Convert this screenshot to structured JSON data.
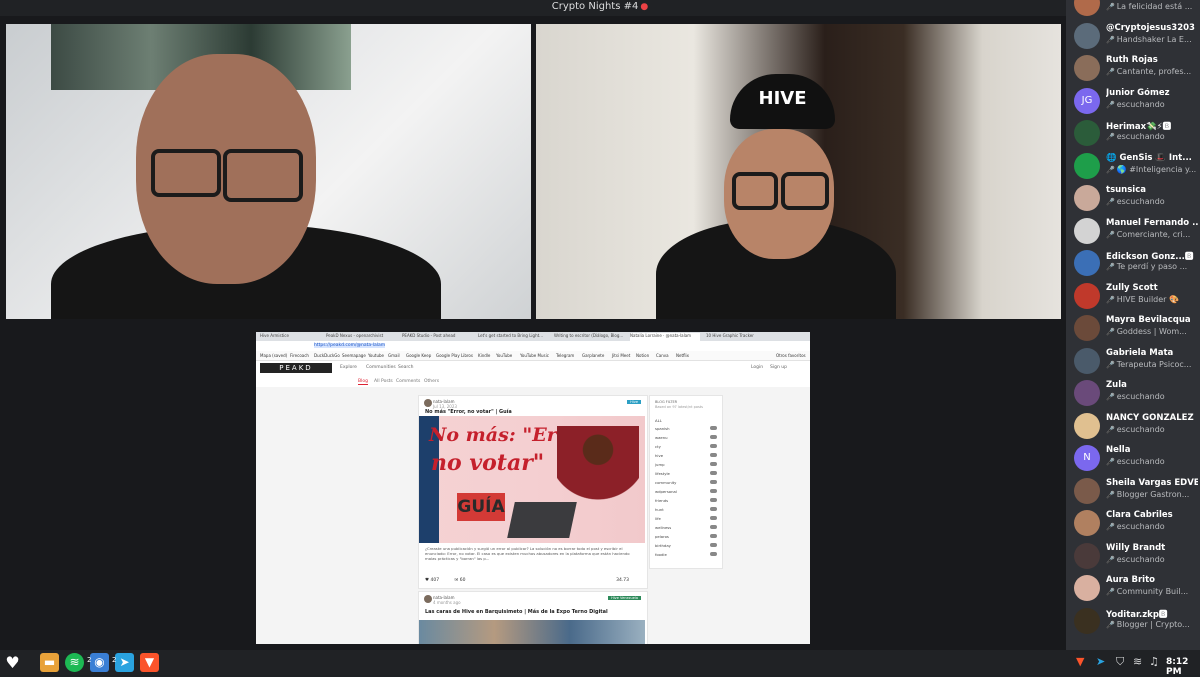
{
  "window": {
    "title": "Crypto Nights #4",
    "minimize": "─",
    "maximize": "❐",
    "close": "✕"
  },
  "video_right": {
    "cap_text": "HIVE"
  },
  "share": {
    "browser_tabs": [
      "Hive Armistice",
      "PeakD Nexus - openarchivist",
      "PEAKD Studio - Post ahead",
      "Let's get started to Bring Light...",
      "Writing to escritor (Diálogo, Blog...",
      "Natalia Lorraine · @nata-lalam",
      "10 Hive Graphic Tracker"
    ],
    "url": "https://peakd.com/@nata-lalam",
    "bookmarks": [
      "Mapa (saved)",
      "Firecoach",
      "DuckDuckGo",
      "Seemapage",
      "Youtube",
      "Gmail",
      "Google Keep",
      "Google Play Libros",
      "Kindle",
      "YouTube",
      "YouTube Music",
      "Telegram",
      "Garplanete",
      "Jitsi Meet",
      "Notion",
      "Canva",
      "Netflix",
      "Otros favoritos"
    ],
    "logo": "PEAKD",
    "nav": [
      "Explore",
      "Communities",
      "Search"
    ],
    "login": "Login",
    "signup": "Sign up",
    "subnav": [
      "Blog",
      "All Posts",
      "Comments",
      "Others"
    ],
    "post1": {
      "author": "nata-lalam",
      "age": "Jul 13, 2023",
      "badge": "Hive",
      "title": "No más \"Error, no votar\" | Guía",
      "image_line1": "No más: \"Error,",
      "image_line2": "no votar\"",
      "image_guia": "GUÍA",
      "excerpt": "¿Creaste una publicación y surgió un error al publicar? La solución no es borrar todo el post y escribir el enunciado: Error, no votar. El caso es que existen muchos abusadores en la plataforma que están haciendo malas prácticas y \"borran\" las p...",
      "votes": "407",
      "comments": "60",
      "payout": "34.73"
    },
    "post2": {
      "author": "nata-lalam",
      "age": "4 months ago",
      "badge": "Hive Venezuela",
      "title": "Las caras de Hive en Barquisimeto | Más de la Expo Terno Digital"
    },
    "filter": {
      "title": "BLOG FILTER",
      "subtitle": "Based on 97 latest/nt posts",
      "items": [
        "ALL",
        "spanish",
        "waenu",
        "cty",
        "hive",
        "jump",
        "lifestyle",
        "community",
        "wdpersonal",
        "friends",
        "hunt",
        "life",
        "wellness",
        "pelaros",
        "birthday",
        "foodie"
      ]
    }
  },
  "members": [
    {
      "name": "",
      "status": "La felicidad está ...",
      "color": "#b06a4a"
    },
    {
      "name": "@Cryptojesus3203",
      "status": "Handshaker La E...",
      "color": "#5b6b7a"
    },
    {
      "name": "Ruth Rojas",
      "status": "Cantante, profes...",
      "color": "#8a6d5a"
    },
    {
      "name": "Junior Gómez",
      "status": "escuchando",
      "color": "#7b68ee",
      "initials": "JG"
    },
    {
      "name": "Herimax💸⚡🅱",
      "status": "escuchando",
      "color": "#2b5c3a"
    },
    {
      "name": "🌐 GenSis 🎩 Int...",
      "status": "🌎 #Inteligencia y...",
      "color": "#1e9e4a"
    },
    {
      "name": "tsunsica",
      "status": "escuchando",
      "color": "#c9a99a"
    },
    {
      "name": "Manuel Fernando ...",
      "status": "Comerciante, cri...",
      "color": "#d3d3d3"
    },
    {
      "name": "Edickson Gonz...🅱",
      "status": "Te perdí y paso ...",
      "color": "#3b6fb6"
    },
    {
      "name": "Zully Scott",
      "status": "HIVE Builder 🎨",
      "color": "#c0392b"
    },
    {
      "name": "Mayra Bevilacqua",
      "status": "Goddess | Wom...",
      "color": "#6b4a3a"
    },
    {
      "name": "Gabriela Mata",
      "status": "Terapeuta Psicoc...",
      "color": "#4a5a6a"
    },
    {
      "name": "Zula",
      "status": "escuchando",
      "color": "#6a4a7a"
    },
    {
      "name": "NANCY GONZALEZ",
      "status": "escuchando",
      "color": "#e0c090"
    },
    {
      "name": "Nella",
      "status": "escuchando",
      "color": "#7b68ee",
      "initials": "N"
    },
    {
      "name": "Sheila Vargas EDVE",
      "status": "Blogger Gastron...",
      "color": "#7a5a4a"
    },
    {
      "name": "Clara Cabriles",
      "status": "escuchando",
      "color": "#b08060"
    },
    {
      "name": "Willy Brandt",
      "status": "escuchando",
      "color": "#4a3a3a"
    },
    {
      "name": "Aura Brito",
      "status": "Community Buil...",
      "color": "#d9b0a0"
    },
    {
      "name": "Yoditar.zkp🅱",
      "status": "Blogger | Crypto...",
      "color": "#3a3020"
    }
  ],
  "taskbar": {
    "badge1": "2",
    "badge2": "2",
    "clock": "8:12 PM"
  }
}
